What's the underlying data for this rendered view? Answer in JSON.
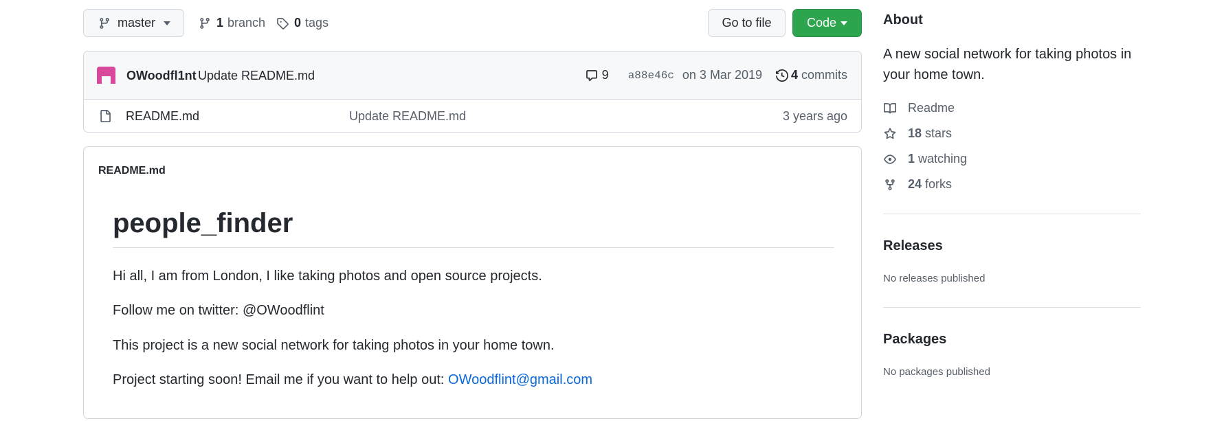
{
  "toolbar": {
    "branch_name": "master",
    "branch_count": "1",
    "branch_label": "branch",
    "tag_count": "0",
    "tag_label": "tags",
    "go_to_file_label": "Go to file",
    "code_label": "Code"
  },
  "latest_commit": {
    "author": "OWoodfl1nt",
    "message": "Update README.md",
    "comment_count": "9",
    "sha": "a88e46c",
    "date": "on 3 Mar 2019",
    "commits_count": "4",
    "commits_label": "commits",
    "avatar_color": "#d9489a"
  },
  "files": [
    {
      "name": "README.md",
      "last_commit": "Update README.md",
      "age": "3 years ago",
      "icon": "file-icon"
    }
  ],
  "readme": {
    "filename": "README.md",
    "heading": "people_finder",
    "paragraphs": [
      "Hi all, I am from London, I like taking photos and open source projects.",
      "Follow me on twitter: @OWoodflint",
      "This project is a new social network for taking photos in your home town."
    ],
    "email_prefix": "Project starting soon! Email me if you want to help out: ",
    "email": "OWoodflint@gmail.com"
  },
  "sidebar": {
    "about_title": "About",
    "description": "A new social network for taking photos in your home town.",
    "readme_label": "Readme",
    "stars_count": "18",
    "stars_label": "stars",
    "watching_count": "1",
    "watching_label": "watching",
    "forks_count": "24",
    "forks_label": "forks",
    "releases_title": "Releases",
    "releases_note": "No releases published",
    "packages_title": "Packages",
    "packages_note": "No packages published"
  },
  "colors": {
    "primary_button": "#2da44e",
    "link": "#0969da",
    "muted_text": "#57606a",
    "border": "#d0d7de"
  }
}
